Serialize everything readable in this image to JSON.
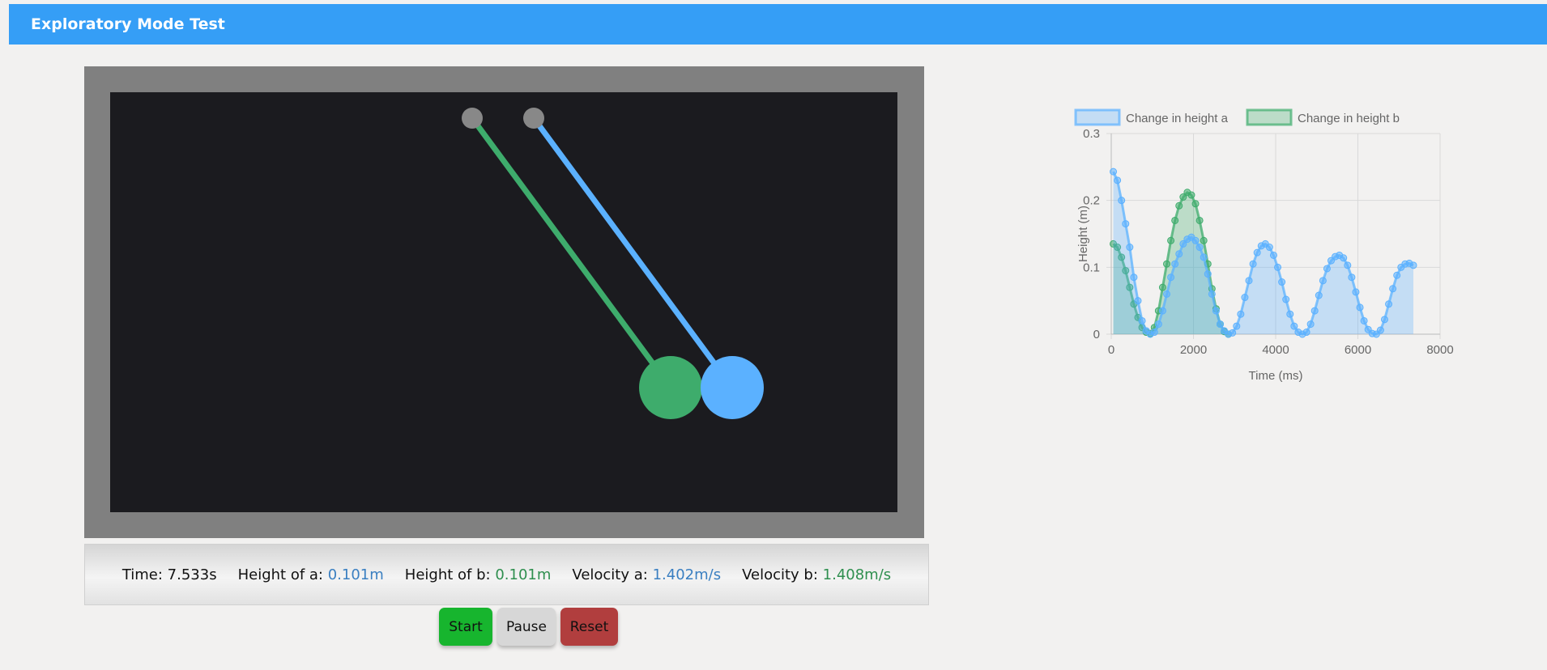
{
  "header": {
    "title": "Exploratory Mode Test"
  },
  "status": {
    "time_label": "Time:",
    "time_value": "7.533s",
    "height_a_label": "Height of a:",
    "height_a_value": "0.101m",
    "height_b_label": "Height of b:",
    "height_b_value": "0.101m",
    "velocity_a_label": "Velocity a:",
    "velocity_a_value": "1.402m/s",
    "velocity_b_label": "Velocity b:",
    "velocity_b_value": "1.408m/s"
  },
  "controls": {
    "start_label": "Start",
    "pause_label": "Pause",
    "reset_label": "Reset"
  },
  "colors": {
    "pendulum_a": "#5bb1ff",
    "pendulum_b": "#3eac6c",
    "pivot": "#888888",
    "header": "#359ef6"
  },
  "chart_data": {
    "type": "area",
    "xlabel": "Time (ms)",
    "ylabel": "Height (m)",
    "xlim": [
      0,
      8000
    ],
    "ylim": [
      0,
      0.3
    ],
    "xticks": [
      0,
      2000,
      4000,
      6000,
      8000
    ],
    "yticks": [
      0,
      0.1,
      0.2,
      0.3
    ],
    "ytick_labels": [
      "0",
      "0.1",
      "0.2",
      "0.3"
    ],
    "grid": true,
    "legend": "top",
    "series": [
      {
        "name": "Change in height a",
        "color": "#5bb1ff",
        "points": [
          [
            50,
            0.243
          ],
          [
            150,
            0.23
          ],
          [
            250,
            0.2
          ],
          [
            350,
            0.165
          ],
          [
            450,
            0.13
          ],
          [
            550,
            0.085
          ],
          [
            650,
            0.05
          ],
          [
            750,
            0.02
          ],
          [
            850,
            0.005
          ],
          [
            950,
            0
          ],
          [
            1050,
            0.003
          ],
          [
            1150,
            0.015
          ],
          [
            1250,
            0.035
          ],
          [
            1350,
            0.06
          ],
          [
            1450,
            0.085
          ],
          [
            1550,
            0.105
          ],
          [
            1650,
            0.12
          ],
          [
            1750,
            0.135
          ],
          [
            1850,
            0.142
          ],
          [
            1950,
            0.145
          ],
          [
            2050,
            0.14
          ],
          [
            2150,
            0.13
          ],
          [
            2250,
            0.115
          ],
          [
            2350,
            0.09
          ],
          [
            2450,
            0.06
          ],
          [
            2550,
            0.035
          ],
          [
            2650,
            0.015
          ],
          [
            2750,
            0.005
          ],
          [
            2850,
            0
          ],
          [
            2950,
            0.002
          ],
          [
            3050,
            0.012
          ],
          [
            3150,
            0.03
          ],
          [
            3250,
            0.055
          ],
          [
            3350,
            0.08
          ],
          [
            3450,
            0.105
          ],
          [
            3550,
            0.122
          ],
          [
            3650,
            0.132
          ],
          [
            3750,
            0.135
          ],
          [
            3850,
            0.13
          ],
          [
            3950,
            0.118
          ],
          [
            4050,
            0.1
          ],
          [
            4150,
            0.078
          ],
          [
            4250,
            0.052
          ],
          [
            4350,
            0.03
          ],
          [
            4450,
            0.012
          ],
          [
            4550,
            0.003
          ],
          [
            4650,
            0
          ],
          [
            4750,
            0.003
          ],
          [
            4850,
            0.015
          ],
          [
            4950,
            0.035
          ],
          [
            5050,
            0.058
          ],
          [
            5150,
            0.08
          ],
          [
            5250,
            0.098
          ],
          [
            5350,
            0.11
          ],
          [
            5450,
            0.116
          ],
          [
            5550,
            0.118
          ],
          [
            5650,
            0.114
          ],
          [
            5750,
            0.103
          ],
          [
            5850,
            0.085
          ],
          [
            5950,
            0.063
          ],
          [
            6050,
            0.04
          ],
          [
            6150,
            0.02
          ],
          [
            6250,
            0.007
          ],
          [
            6350,
            0.001
          ],
          [
            6450,
            0
          ],
          [
            6550,
            0.006
          ],
          [
            6650,
            0.022
          ],
          [
            6750,
            0.045
          ],
          [
            6850,
            0.068
          ],
          [
            6950,
            0.088
          ],
          [
            7050,
            0.1
          ],
          [
            7150,
            0.105
          ],
          [
            7250,
            0.106
          ],
          [
            7350,
            0.103
          ]
        ]
      },
      {
        "name": "Change in height b",
        "color": "#3eac6c",
        "points": [
          [
            50,
            0.135
          ],
          [
            150,
            0.13
          ],
          [
            250,
            0.115
          ],
          [
            350,
            0.095
          ],
          [
            450,
            0.07
          ],
          [
            550,
            0.045
          ],
          [
            650,
            0.025
          ],
          [
            750,
            0.01
          ],
          [
            850,
            0.003
          ],
          [
            950,
            0.001
          ],
          [
            1050,
            0.01
          ],
          [
            1150,
            0.035
          ],
          [
            1250,
            0.07
          ],
          [
            1350,
            0.105
          ],
          [
            1450,
            0.14
          ],
          [
            1550,
            0.17
          ],
          [
            1650,
            0.192
          ],
          [
            1750,
            0.205
          ],
          [
            1850,
            0.212
          ],
          [
            1950,
            0.208
          ],
          [
            2050,
            0.195
          ],
          [
            2150,
            0.17
          ],
          [
            2250,
            0.14
          ],
          [
            2350,
            0.105
          ],
          [
            2450,
            0.068
          ],
          [
            2550,
            0.038
          ],
          [
            2650,
            0.015
          ],
          [
            2750,
            0.004
          ],
          [
            2850,
            0
          ]
        ]
      }
    ]
  }
}
